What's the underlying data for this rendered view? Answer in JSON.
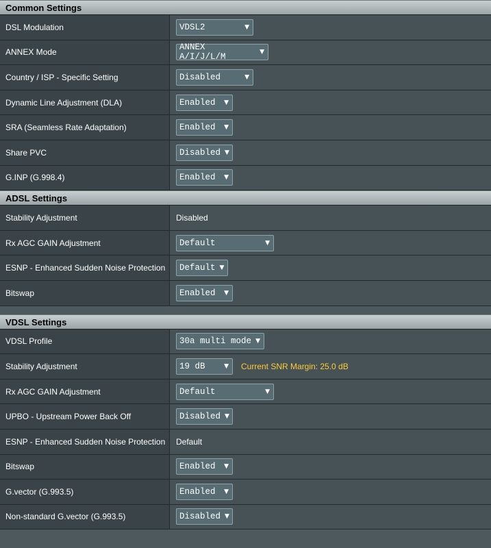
{
  "common": {
    "title": "Common Settings",
    "rows": [
      {
        "label": "DSL Modulation",
        "value": "VDSL2"
      },
      {
        "label": "ANNEX Mode",
        "value": "ANNEX A/I/J/L/M"
      },
      {
        "label": "Country / ISP - Specific Setting",
        "value": "Disabled"
      },
      {
        "label": "Dynamic Line Adjustment (DLA)",
        "value": "Enabled"
      },
      {
        "label": "SRA (Seamless Rate Adaptation)",
        "value": "Enabled"
      },
      {
        "label": "Share PVC",
        "value": "Disabled"
      },
      {
        "label": "G.INP (G.998.4)",
        "value": "Enabled"
      }
    ]
  },
  "adsl": {
    "title": "ADSL Settings",
    "rows": [
      {
        "label": "Stability Adjustment",
        "value": "Disabled"
      },
      {
        "label": "Rx AGC GAIN Adjustment",
        "value": "Default"
      },
      {
        "label": "ESNP - Enhanced Sudden Noise Protection",
        "value": "Default"
      },
      {
        "label": "Bitswap",
        "value": "Enabled"
      }
    ]
  },
  "vdsl": {
    "title": "VDSL Settings",
    "snr_hint": "Current SNR Margin: 25.0 dB",
    "rows": [
      {
        "label": "VDSL Profile",
        "value": "30a multi mode"
      },
      {
        "label": "Stability Adjustment",
        "value": "19 dB"
      },
      {
        "label": "Rx AGC GAIN Adjustment",
        "value": "Default"
      },
      {
        "label": "UPBO - Upstream Power Back Off",
        "value": "Disabled"
      },
      {
        "label": "ESNP - Enhanced Sudden Noise Protection",
        "value": "Default"
      },
      {
        "label": "Bitswap",
        "value": "Enabled"
      },
      {
        "label": "G.vector (G.993.5)",
        "value": "Enabled"
      },
      {
        "label": "Non-standard G.vector (G.993.5)",
        "value": "Disabled"
      }
    ]
  },
  "colors": {
    "background": "#4d595d",
    "label_bg": "#3a4448",
    "select_bg": "#576d73",
    "hint": "#ffcc33"
  },
  "icons": {
    "dropdown": "caret-down-icon"
  }
}
